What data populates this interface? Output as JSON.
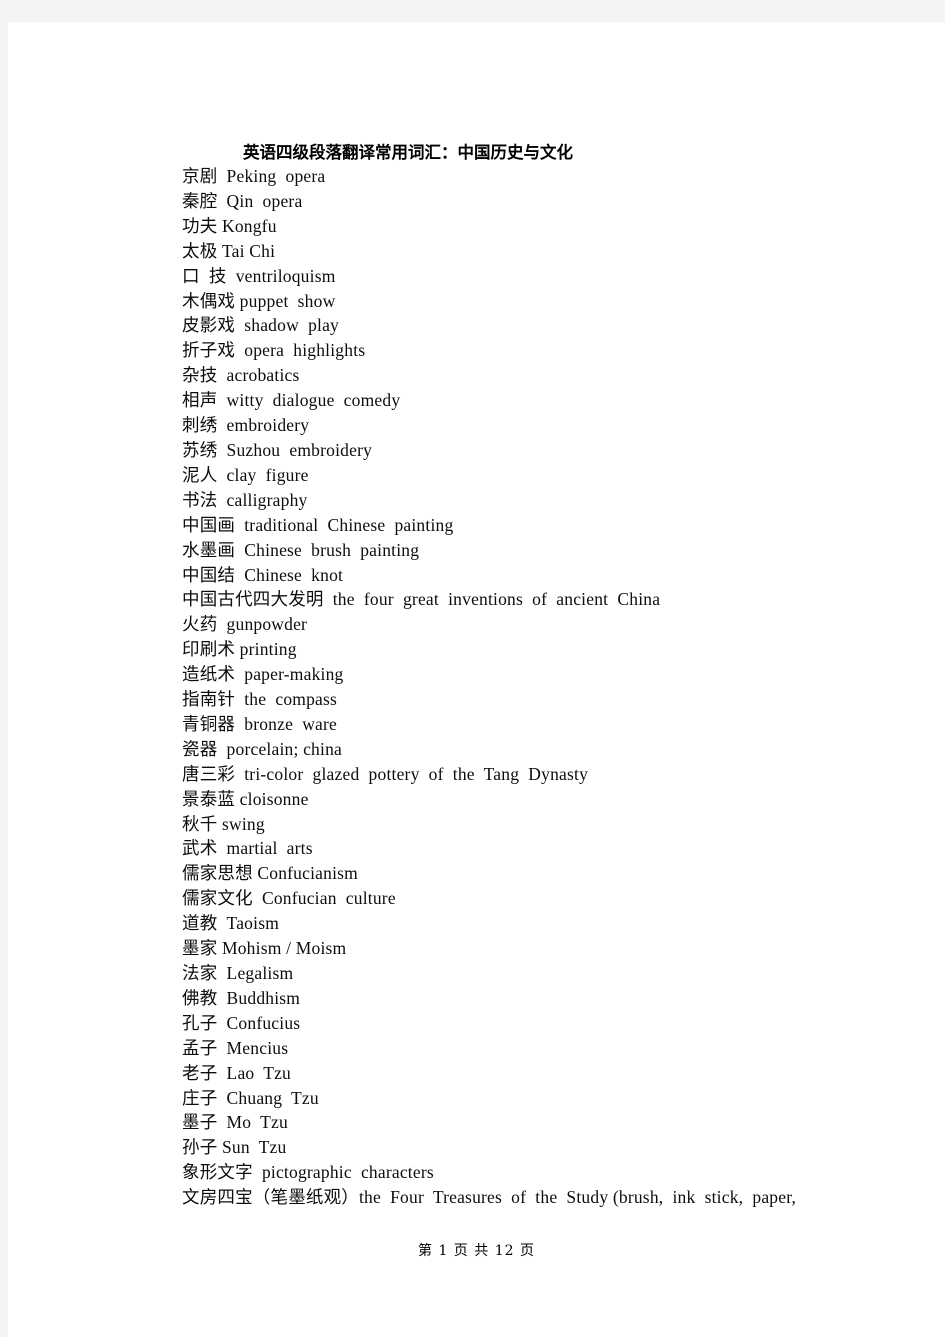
{
  "document": {
    "title": "英语四级段落翻译常用词汇：中国历史与文化",
    "footer": "第 1 页 共 12 页",
    "page_number": "1",
    "total_pages": "12",
    "background_color": "#f4f4f4",
    "page_color": "#ffffff",
    "text_color": "#0d0d0d"
  },
  "entries": [
    {
      "cn": "京剧",
      "en": "Peking  opera",
      "line": "京剧  Peking  opera"
    },
    {
      "cn": "秦腔",
      "en": "Qin  opera",
      "line": "秦腔  Qin  opera"
    },
    {
      "cn": "功夫",
      "en": "Kongfu",
      "line": "功夫 Kongfu"
    },
    {
      "cn": "太极",
      "en": "Tai Chi",
      "line": "太极 Tai Chi"
    },
    {
      "cn": "口 技",
      "en": "ventriloquism",
      "line": "口  技  ventriloquism"
    },
    {
      "cn": "木偶戏",
      "en": "puppet  show",
      "line": "木偶戏 puppet  show"
    },
    {
      "cn": "皮影戏",
      "en": "shadow  play",
      "line": "皮影戏  shadow  play"
    },
    {
      "cn": "折子戏",
      "en": "opera  highlights",
      "line": "折子戏  opera  highlights"
    },
    {
      "cn": "杂技",
      "en": "acrobatics",
      "line": "杂技  acrobatics"
    },
    {
      "cn": "相声",
      "en": "witty  dialogue  comedy",
      "line": "相声  witty  dialogue  comedy"
    },
    {
      "cn": "刺绣",
      "en": "embroidery",
      "line": "刺绣  embroidery"
    },
    {
      "cn": "苏绣",
      "en": "Suzhou  embroidery",
      "line": "苏绣  Suzhou  embroidery"
    },
    {
      "cn": "泥人",
      "en": "clay  figure",
      "line": "泥人  clay  figure"
    },
    {
      "cn": "书法",
      "en": "calligraphy",
      "line": "书法  calligraphy"
    },
    {
      "cn": "中国画",
      "en": "traditional  Chinese  painting",
      "line": "中国画  traditional  Chinese  painting"
    },
    {
      "cn": "水墨画",
      "en": "Chinese  brush  painting",
      "line": "水墨画  Chinese  brush  painting"
    },
    {
      "cn": "中国结",
      "en": "Chinese  knot",
      "line": "中国结  Chinese  knot"
    },
    {
      "cn": "中国古代四大发明",
      "en": "the  four  great  inventions  of  ancient  China",
      "line": "中国古代四大发明  the  four  great  inventions  of  ancient  China"
    },
    {
      "cn": "火药",
      "en": "gunpowder",
      "line": "火药  gunpowder"
    },
    {
      "cn": "印刷术",
      "en": "printing",
      "line": "印刷术 printing"
    },
    {
      "cn": "造纸术",
      "en": "paper-making",
      "line": "造纸术  paper-making"
    },
    {
      "cn": "指南针",
      "en": "the  compass",
      "line": "指南针  the  compass"
    },
    {
      "cn": "青铜器",
      "en": "bronze  ware",
      "line": "青铜器  bronze  ware"
    },
    {
      "cn": "瓷器",
      "en": "porcelain; china",
      "line": "瓷器  porcelain; china"
    },
    {
      "cn": "唐三彩",
      "en": "tri-color  glazed  pottery  of  the  Tang  Dynasty",
      "line": "唐三彩  tri-color  glazed  pottery  of  the  Tang  Dynasty"
    },
    {
      "cn": "景泰蓝",
      "en": "cloisonne",
      "line": "景泰蓝 cloisonne"
    },
    {
      "cn": "秋千",
      "en": "swing",
      "line": "秋千 swing"
    },
    {
      "cn": "武术",
      "en": "martial  arts",
      "line": "武术  martial  arts"
    },
    {
      "cn": "儒家思想",
      "en": "Confucianism",
      "line": "儒家思想 Confucianism"
    },
    {
      "cn": "儒家文化",
      "en": "Confucian  culture",
      "line": "儒家文化  Confucian  culture"
    },
    {
      "cn": "道教",
      "en": "Taoism",
      "line": "道教  Taoism"
    },
    {
      "cn": "墨家",
      "en": "Mohism / Moism",
      "line": "墨家 Mohism / Moism"
    },
    {
      "cn": "法家",
      "en": "Legalism",
      "line": "法家  Legalism"
    },
    {
      "cn": "佛教",
      "en": "Buddhism",
      "line": "佛教  Buddhism"
    },
    {
      "cn": "孔子",
      "en": "Confucius",
      "line": "孔子  Confucius"
    },
    {
      "cn": "孟子",
      "en": "Mencius",
      "line": "孟子  Mencius"
    },
    {
      "cn": "老子",
      "en": "Lao  Tzu",
      "line": "老子  Lao  Tzu"
    },
    {
      "cn": "庄子",
      "en": "Chuang  Tzu",
      "line": "庄子  Chuang  Tzu"
    },
    {
      "cn": "墨子",
      "en": "Mo  Tzu",
      "line": "墨子  Mo  Tzu"
    },
    {
      "cn": "孙子",
      "en": "Sun  Tzu",
      "line": "孙子 Sun  Tzu"
    },
    {
      "cn": "象形文字",
      "en": "pictographic  characters",
      "line": "象形文字  pictographic  characters"
    },
    {
      "cn": "文房四宝（笔墨纸观）",
      "en": "the  Four  Treasures  of  the  Study (brush,  ink  stick,  paper,",
      "line": "文房四宝（笔墨纸观）the  Four  Treasures  of  the  Study (brush,  ink  stick,  paper,"
    }
  ]
}
